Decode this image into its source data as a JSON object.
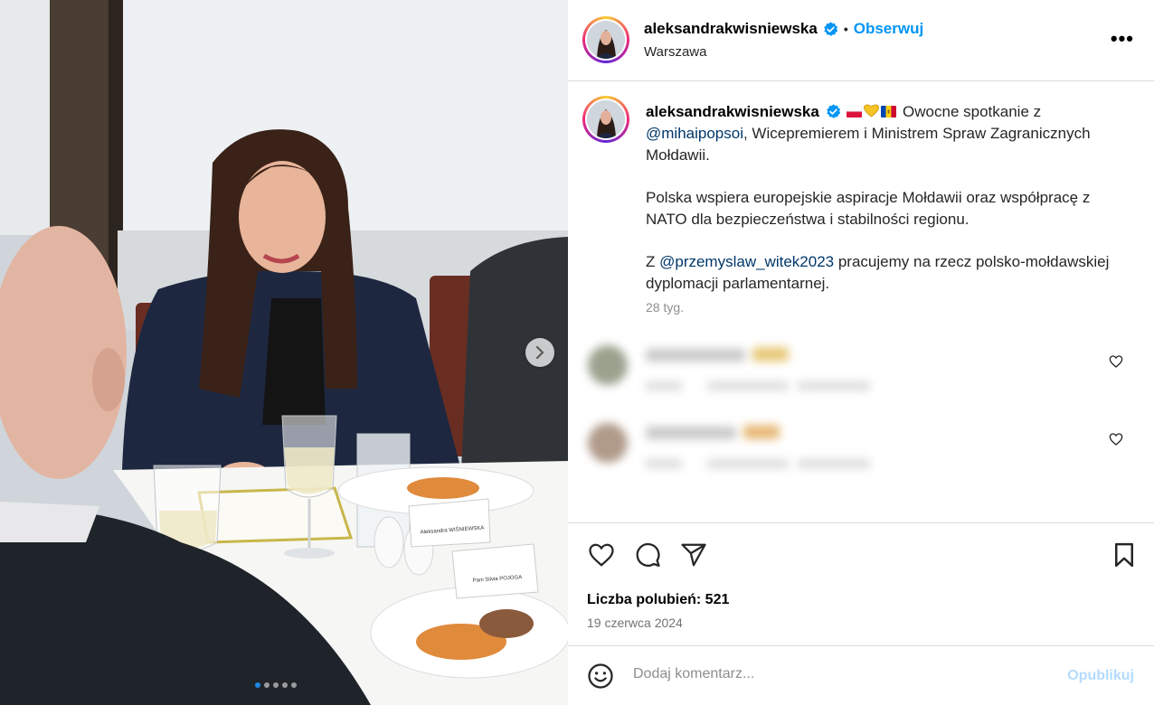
{
  "post": {
    "username": "aleksandrakwisniewska",
    "follow_label": "Obserwuj",
    "separator": "•",
    "location": "Warszawa",
    "more_label": "•••",
    "caption": {
      "username": "aleksandrakwisniewska",
      "flags": [
        "flag-poland",
        "yellow-heart",
        "flag-moldova"
      ],
      "line1_text": " Owocne spotkanie z ",
      "mention1": "@mihaipopsoi",
      "line1_rest": ", Wicepremierem i Ministrem Spraw Zagranicznych Mołdawii.",
      "paragraph2": "Polska wspiera europejskie aspiracje Mołdawii oraz współpracę z NATO dla bezpieczeństwa i stabilności regionu.",
      "p3_prefix": "Z ",
      "mention2": "@przemyslaw_witek2023",
      "p3_rest": " pracujemy na rzecz polsko-mołdawskiej dyplomacji parlamentarnej."
    },
    "time_ago": "28 tyg.",
    "likes_label": "Liczba polubień: 521",
    "date": "19 czerwca 2024",
    "comment_placeholder": "Dodaj komentarz...",
    "publish_label": "Opublikuj"
  },
  "photo": {
    "name_card_1": "Aleksandra WIŚNIEWSKA",
    "name_card_2": "Pani Silvia POJOGA",
    "carousel_total": 5,
    "carousel_active": 1
  },
  "icons": {
    "verified": "verified-badge-icon",
    "like": "heart-icon",
    "comment": "comment-bubble-icon",
    "share": "paper-plane-icon",
    "save": "bookmark-icon",
    "emoji": "smiley-icon",
    "next": "chevron-right-icon"
  },
  "colors": {
    "accent": "#0095f6",
    "mention": "#00376b",
    "muted": "#8e8e8e",
    "publish_disabled": "#b3dbff",
    "carousel_active": "#1e88e5"
  }
}
